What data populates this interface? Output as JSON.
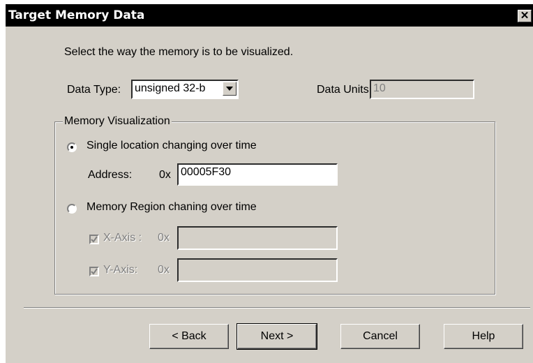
{
  "window": {
    "title": "Target Memory Data",
    "close_glyph": "✕"
  },
  "instruction": "Select the way the memory is to be visualized.",
  "data_type": {
    "label": "Data Type:",
    "value": "unsigned 32-b"
  },
  "data_units": {
    "label": "Data Units:",
    "value": "10"
  },
  "group": {
    "label": "Memory Visualization",
    "single": {
      "label": "Single location changing over time",
      "selected": true
    },
    "address": {
      "label": "Address:",
      "prefix": "0x",
      "value": "00005F30"
    },
    "region": {
      "label": "Memory Region chaning over time",
      "selected": false
    },
    "x_axis": {
      "label": "X-Axis :",
      "prefix": "0x",
      "value": "",
      "checked": true
    },
    "y_axis": {
      "label": "Y-Axis:",
      "prefix": "0x",
      "value": "",
      "checked": true
    }
  },
  "buttons": {
    "back": "< Back",
    "next": "Next >",
    "cancel": "Cancel",
    "help": "Help"
  },
  "icons": {
    "dropdown": "chevron-down-icon",
    "close": "close-icon",
    "check": "check-icon"
  }
}
